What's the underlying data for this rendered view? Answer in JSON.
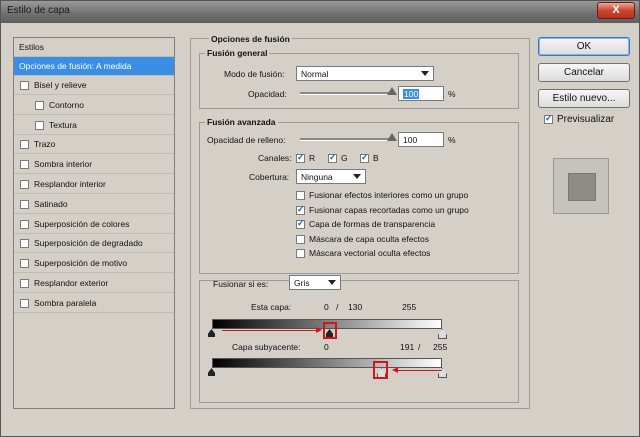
{
  "window": {
    "title": "Estilo de capa",
    "close_label": "X"
  },
  "styles_panel": {
    "header": "Estilos",
    "selected": "Opciones de fusión: A medida",
    "items": [
      {
        "label": "Bisel y relieve",
        "checked": false,
        "indent": false
      },
      {
        "label": "Contorno",
        "checked": false,
        "indent": true
      },
      {
        "label": "Textura",
        "checked": false,
        "indent": true
      },
      {
        "label": "Trazo",
        "checked": false,
        "indent": false
      },
      {
        "label": "Sombra interior",
        "checked": false,
        "indent": false
      },
      {
        "label": "Resplandor interior",
        "checked": false,
        "indent": false
      },
      {
        "label": "Satinado",
        "checked": false,
        "indent": false
      },
      {
        "label": "Superposición de colores",
        "checked": false,
        "indent": false
      },
      {
        "label": "Superposición de degradado",
        "checked": false,
        "indent": false
      },
      {
        "label": "Superposición de motivo",
        "checked": false,
        "indent": false
      },
      {
        "label": "Resplandor exterior",
        "checked": false,
        "indent": false
      },
      {
        "label": "Sombra paralela",
        "checked": false,
        "indent": false
      }
    ]
  },
  "blending": {
    "section_title": "Opciones de fusión",
    "general": {
      "title": "Fusión general",
      "mode_label": "Modo de fusión:",
      "mode_value": "Normal",
      "opacity_label": "Opacidad:",
      "opacity_value": "100",
      "opacity_unit": "%",
      "opacity_level": 100
    },
    "advanced": {
      "title": "Fusión avanzada",
      "fill_label": "Opacidad de relleno:",
      "fill_value": "100",
      "fill_unit": "%",
      "fill_level": 100,
      "channels_label": "Canales:",
      "channels": [
        {
          "label": "R",
          "checked": true
        },
        {
          "label": "G",
          "checked": true
        },
        {
          "label": "B",
          "checked": true
        }
      ],
      "knockout_label": "Cobertura:",
      "knockout_value": "Ninguna",
      "options": [
        {
          "label": "Fusionar efectos interiores como un grupo",
          "checked": false
        },
        {
          "label": "Fusionar capas recortadas como un grupo",
          "checked": true
        },
        {
          "label": "Capa de formas de transparencia",
          "checked": true
        },
        {
          "label": "Máscara de capa oculta efectos",
          "checked": false
        },
        {
          "label": "Máscara vectorial oculta efectos",
          "checked": false
        }
      ]
    },
    "blend_if": {
      "label": "Fusionar si es:",
      "value": "Gris",
      "this_layer_label": "Esta capa:",
      "this_layer_black": "0",
      "this_layer_sep": "/",
      "this_layer_split": "130",
      "this_layer_white": "255",
      "underlying_label": "Capa subyacente:",
      "underlying_black": "0",
      "underlying_split": "191",
      "underlying_sep": "/",
      "underlying_white": "255"
    }
  },
  "buttons": {
    "ok": "OK",
    "cancel": "Cancelar",
    "new_style": "Estilo nuevo...",
    "preview_label": "Previsualizar",
    "preview_checked": true
  },
  "colors": {
    "selection": "#3a8ee6",
    "annotation": "#d4141c"
  }
}
